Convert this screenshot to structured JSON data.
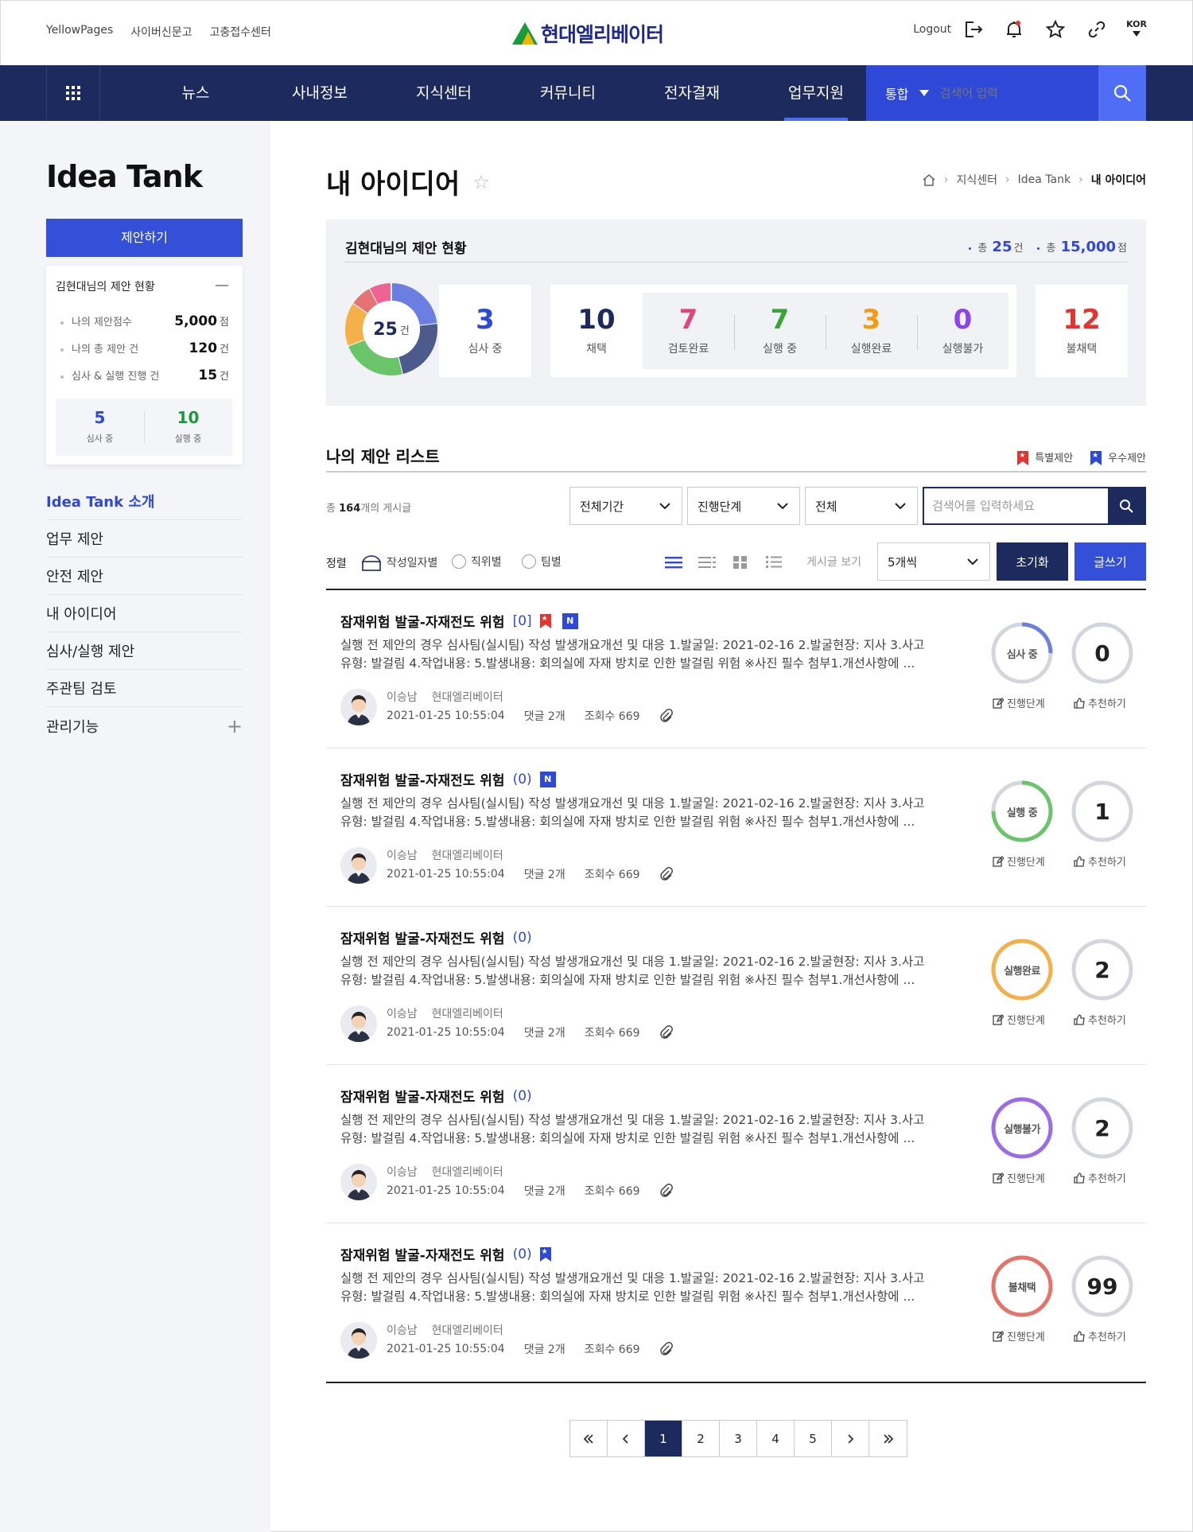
{
  "util": {
    "links": [
      "YellowPages",
      "사이버신문고",
      "고충접수센터"
    ],
    "logo_text": "현대엘리베이터",
    "logout": "Logout",
    "lang": "KOR"
  },
  "gnb": {
    "menu": [
      "뉴스",
      "사내정보",
      "지식센터",
      "커뮤니티",
      "전자결재",
      "업무지원"
    ],
    "active_index": 5,
    "search_scope": "통합",
    "search_placeholder": "검색어 입력"
  },
  "sidebar": {
    "title": "Idea Tank",
    "propose_button": "제안하기",
    "status_title": "김현대님의 제안 현황",
    "rows": [
      {
        "label": "나의 제안점수",
        "value": "5,000",
        "unit": "점"
      },
      {
        "label": "나의 총 제안 건",
        "value": "120",
        "unit": "건"
      },
      {
        "label": "심사 & 실행 진행 건",
        "value": "15",
        "unit": "건"
      }
    ],
    "mini": [
      {
        "value": "5",
        "label": "심사 중",
        "color": "#2e48d8"
      },
      {
        "value": "10",
        "label": "실행 중",
        "color": "#1a9b3a"
      }
    ],
    "nav": [
      "Idea Tank 소개",
      "업무 제안",
      "안전 제안",
      "내 아이디어",
      "심사/실행 제안",
      "주관팀 검토",
      "관리기능"
    ],
    "nav_active": 0
  },
  "page": {
    "title": "내 아이디어",
    "breadcrumb": [
      "지식센터",
      "Idea Tank",
      "내 아이디어"
    ]
  },
  "summary": {
    "title": "김현대님의 제안 현황",
    "total_count_label": "총",
    "total_count": "25",
    "total_count_unit": "건",
    "total_score_label": "총",
    "total_score": "15,000",
    "total_score_unit": "점",
    "donut_value": "25",
    "donut_unit": "건",
    "donut_colors": [
      "#6b7fe3",
      "#4d5a8c",
      "#6ac56a",
      "#f5b04a",
      "#e57373",
      "#f06292"
    ],
    "stats": [
      {
        "value": "3",
        "label": "심사 중",
        "color": "#2e48d8"
      },
      {
        "value": "10",
        "label": "채택",
        "color": "#1d2a5e"
      },
      {
        "value": "7",
        "label": "검토완료",
        "color": "#e0457b"
      },
      {
        "value": "7",
        "label": "실행 중",
        "color": "#3aa53a"
      },
      {
        "value": "3",
        "label": "실행완료",
        "color": "#f39c12"
      },
      {
        "value": "0",
        "label": "실행불가",
        "color": "#8e44e8"
      },
      {
        "value": "12",
        "label": "불채택",
        "color": "#e3342f"
      }
    ]
  },
  "list": {
    "title": "나의 제안 리스트",
    "legend_special": "특별제안",
    "legend_excellent": "우수제안",
    "count_prefix": "총",
    "count": "164",
    "count_suffix": "개의 게시글",
    "filter_period": "전체기간",
    "filter_stage": "진행단계",
    "filter_all": "전체",
    "search_placeholder": "검색어를 입력하세요",
    "sort_label": "정렬",
    "sort_options": [
      "작성일자별",
      "직위별",
      "팀별"
    ],
    "view_label": "게시글 보기",
    "per_page": "5개씩",
    "reset_button": "초기화",
    "write_button": "글쓰기",
    "stage_action": "진행단계",
    "recommend_action": "추천하기",
    "items": [
      {
        "title": "잠재위험 발굴-자재전도 위험",
        "comments": "[0]",
        "desc": "실행 전 제안의 경우 심사팀(실시팀) 작성 발생개요개선 및 대응 1.발굴일: 2021-02-16 2.발굴현장: 지사 3.사고유형: 발걸림 4.작업내용: 5.발생내용: 회의실에 자재 방치로 인한 발걸림 위험 ※사진 필수 첨부1.개선사항에 ...",
        "author": "이승남",
        "company": "현대엘리베이터",
        "date": "2021-01-25 10:55:04",
        "reply": "댓글 2개",
        "views": "조회수 669",
        "status": "심사 중",
        "status_color": "#6b7fe3",
        "progress": 0.25,
        "recommend": "0",
        "badges": [
          "special",
          "new"
        ]
      },
      {
        "title": "잠재위험 발굴-자재전도 위험",
        "comments": "(0)",
        "desc": "실행 전 제안의 경우 심사팀(실시팀) 작성 발생개요개선 및 대응 1.발굴일: 2021-02-16 2.발굴현장: 지사 3.사고유형: 발걸림 4.작업내용: 5.발생내용: 회의실에 자재 방치로 인한 발걸림 위험 ※사진 필수 첨부1.개선사항에 ...",
        "author": "이승남",
        "company": "현대엘리베이터",
        "date": "2021-01-25 10:55:04",
        "reply": "댓글 2개",
        "views": "조회수 669",
        "status": "실행 중",
        "status_color": "#6ac56a",
        "progress": 0.75,
        "recommend": "1",
        "badges": [
          "new"
        ]
      },
      {
        "title": "잠재위험 발굴-자재전도 위험",
        "comments": "(0)",
        "desc": "실행 전 제안의 경우 심사팀(실시팀) 작성 발생개요개선 및 대응 1.발굴일: 2021-02-16 2.발굴현장: 지사 3.사고유형: 발걸림 4.작업내용: 5.발생내용: 회의실에 자재 방치로 인한 발걸림 위험 ※사진 필수 첨부1.개선사항에 ...",
        "author": "이승남",
        "company": "현대엘리베이터",
        "date": "2021-01-25 10:55:04",
        "reply": "댓글 2개",
        "views": "조회수 669",
        "status": "실행완료",
        "status_color": "#f5b04a",
        "progress": 1.0,
        "recommend": "2",
        "badges": []
      },
      {
        "title": "잠재위험 발굴-자재전도 위험",
        "comments": "(0)",
        "desc": "실행 전 제안의 경우 심사팀(실시팀) 작성 발생개요개선 및 대응 1.발굴일: 2021-02-16 2.발굴현장: 지사 3.사고유형: 발걸림 4.작업내용: 5.발생내용: 회의실에 자재 방치로 인한 발걸림 위험 ※사진 필수 첨부1.개선사항에 ...",
        "author": "이승남",
        "company": "현대엘리베이터",
        "date": "2021-01-25 10:55:04",
        "reply": "댓글 2개",
        "views": "조회수 669",
        "status": "실행불가",
        "status_color": "#9b6be8",
        "progress": 1.0,
        "recommend": "2",
        "badges": []
      },
      {
        "title": "잠재위험 발굴-자재전도 위험",
        "comments": "(0)",
        "desc": "실행 전 제안의 경우 심사팀(실시팀) 작성 발생개요개선 및 대응 1.발굴일: 2021-02-16 2.발굴현장: 지사 3.사고유형: 발걸림 4.작업내용: 5.발생내용: 회의실에 자재 방치로 인한 발걸림 위험 ※사진 필수 첨부1.개선사항에 ...",
        "author": "이승남",
        "company": "현대엘리베이터",
        "date": "2021-01-25 10:55:04",
        "reply": "댓글 2개",
        "views": "조회수 669",
        "status": "불채택",
        "status_color": "#e57368",
        "progress": 1.0,
        "recommend": "99",
        "badges": [
          "excellent"
        ]
      }
    ]
  },
  "pagination": {
    "pages": [
      "1",
      "2",
      "3",
      "4",
      "5"
    ],
    "current": 0
  }
}
